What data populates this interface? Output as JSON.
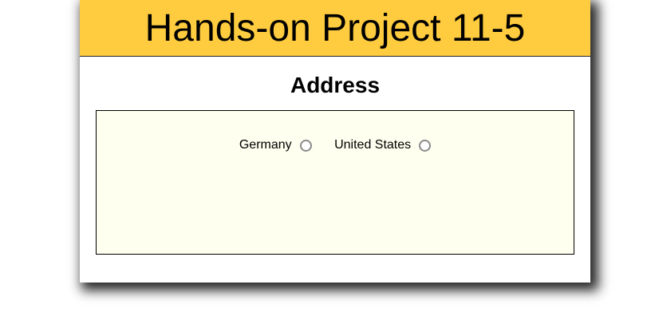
{
  "header": {
    "title": "Hands-on Project 11-5"
  },
  "section": {
    "title": "Address"
  },
  "address": {
    "countries": [
      {
        "label": "Germany",
        "checked": false
      },
      {
        "label": "United States",
        "checked": false
      }
    ]
  },
  "colors": {
    "banner": "#ffcc3f",
    "box_background": "#fffff0"
  }
}
